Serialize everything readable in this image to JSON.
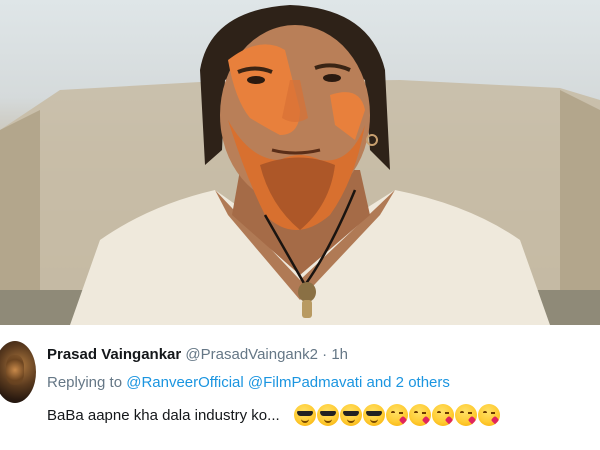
{
  "tweet": {
    "author_name": "Prasad Vaingankar",
    "author_handle": "@PrasadVaingank2",
    "separator": "·",
    "time": "1h",
    "replying_prefix": "Replying to",
    "mention_1": "@RanveerOfficial",
    "mention_2": "@FilmPadmavati",
    "replying_suffix": "and 2 others",
    "text": "BaBa aapne kha dala industry ko...",
    "emojis": [
      "smiling-face-with-sunglasses-icon",
      "smiling-face-with-sunglasses-icon",
      "smiling-face-with-sunglasses-icon",
      "smiling-face-with-sunglasses-icon",
      "face-blowing-kiss-icon",
      "face-blowing-kiss-icon",
      "face-blowing-kiss-icon",
      "face-blowing-kiss-icon",
      "face-blowing-kiss-icon"
    ]
  },
  "colors": {
    "link": "#1b95e0",
    "name": "#14171a",
    "secondary": "#657786",
    "face_paint": "#e8803c"
  }
}
